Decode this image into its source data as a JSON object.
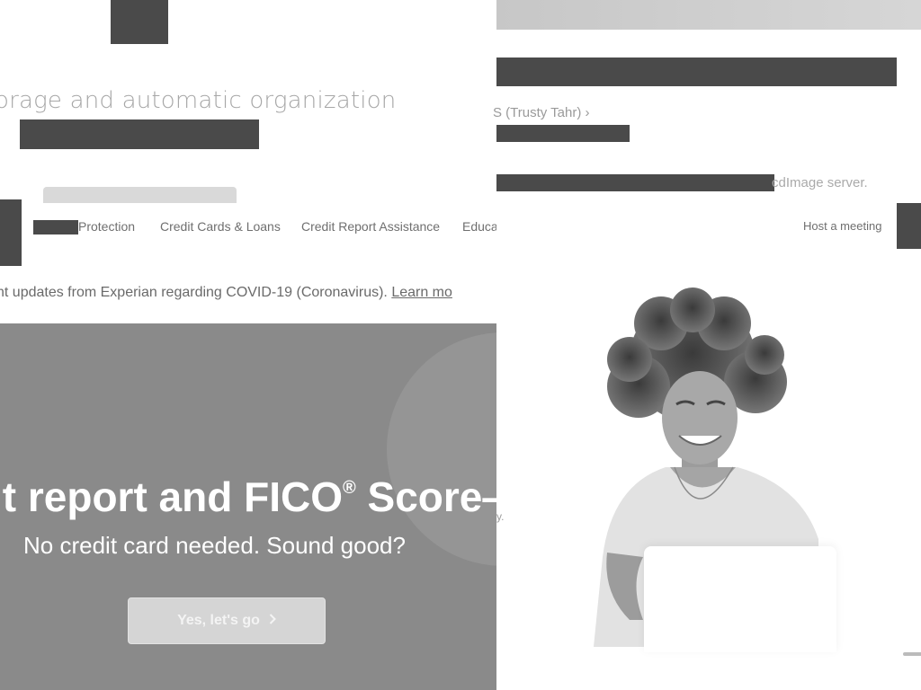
{
  "top_fragment": {
    "title": "orage and automatic organization"
  },
  "nav": {
    "items": [
      "Protection",
      "Credit Cards & Loans",
      "Credit Report Assistance",
      "Educa"
    ]
  },
  "notice": {
    "text": "nt updates from Experian regarding COVID-19 (Coronavirus).",
    "link_text": "Learn mo"
  },
  "hero": {
    "title": "it report and FICO",
    "title_sup": "®",
    "title_after": " Score—",
    "subtitle": "No credit card needed. Sound good?",
    "cta_label": "Yes, let's go",
    "cta_icon": "chevron-right-icon"
  },
  "right_fragment": {
    "link_text": "S (Trusty Tahr) ›",
    "tail_text": "cdImage server.",
    "host_meeting": "Host a meeting",
    "fragment_char": "y."
  },
  "colors": {
    "hero_bg": "#8a8a8a",
    "redaction": "#4a4a4a",
    "page_bg": "#ffffff"
  }
}
